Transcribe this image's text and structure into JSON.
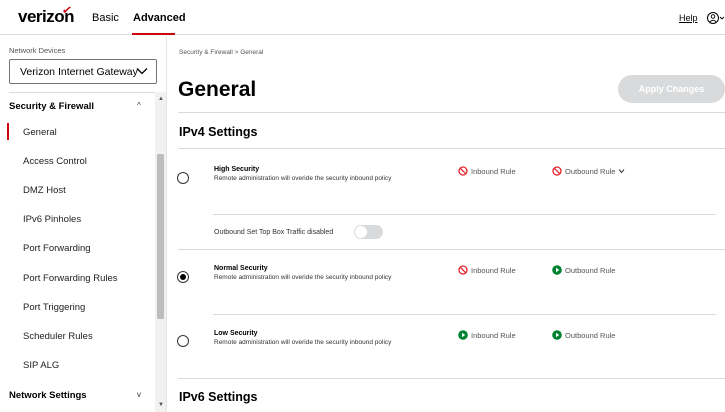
{
  "header": {
    "brand": "verizon",
    "tabs": [
      "Basic",
      "Advanced"
    ],
    "active_tab": "Advanced",
    "help": "Help"
  },
  "sidebar": {
    "devices_label": "Network Devices",
    "device_select": "Verizon Internet Gateway",
    "section": "Security & Firewall",
    "items": [
      "General",
      "Access Control",
      "DMZ Host",
      "IPv6 Pinholes",
      "Port Forwarding",
      "Port Forwarding Rules",
      "Port Triggering",
      "Scheduler Rules",
      "SIP ALG"
    ],
    "active_item": "General",
    "next_section": "Network Settings"
  },
  "main": {
    "breadcrumb": "Security & Firewall  >  General",
    "title": "General",
    "apply_button": "Apply Changes",
    "ipv4_title": "IPv4 Settings",
    "ipv6_title": "IPv6 Settings",
    "options": [
      {
        "title": "High Security",
        "desc": "Remote administration will overide the security inbound policy",
        "selected": false,
        "inbound": "Inbound Rule",
        "inbound_state": "blocked",
        "outbound": "Outbound Rule",
        "outbound_state": "blocked"
      },
      {
        "title": "Normal Security",
        "desc": "Remote administration will overide the security inbound policy",
        "selected": true,
        "inbound": "Inbound Rule",
        "inbound_state": "blocked",
        "outbound": "Outbound Rule",
        "outbound_state": "allowed"
      },
      {
        "title": "Low Security",
        "desc": "Remote administration will overide the security inbound policy",
        "selected": false,
        "inbound": "Inbound Rule",
        "inbound_state": "allowed",
        "outbound": "Outbound Rule",
        "outbound_state": "allowed"
      }
    ],
    "toggle_label": "Outbound Set Top Box Traffic disabled",
    "toggle_on": false
  },
  "colors": {
    "brand_red": "#cd040b",
    "blocked": "#e3242b",
    "allowed": "#008331",
    "disabled_button": "#d8dadc"
  },
  "icons": {
    "blocked": "no-entry-icon",
    "allowed": "play-circle-icon",
    "user": "user-circle-icon",
    "chevron": "chevron-down-icon"
  }
}
